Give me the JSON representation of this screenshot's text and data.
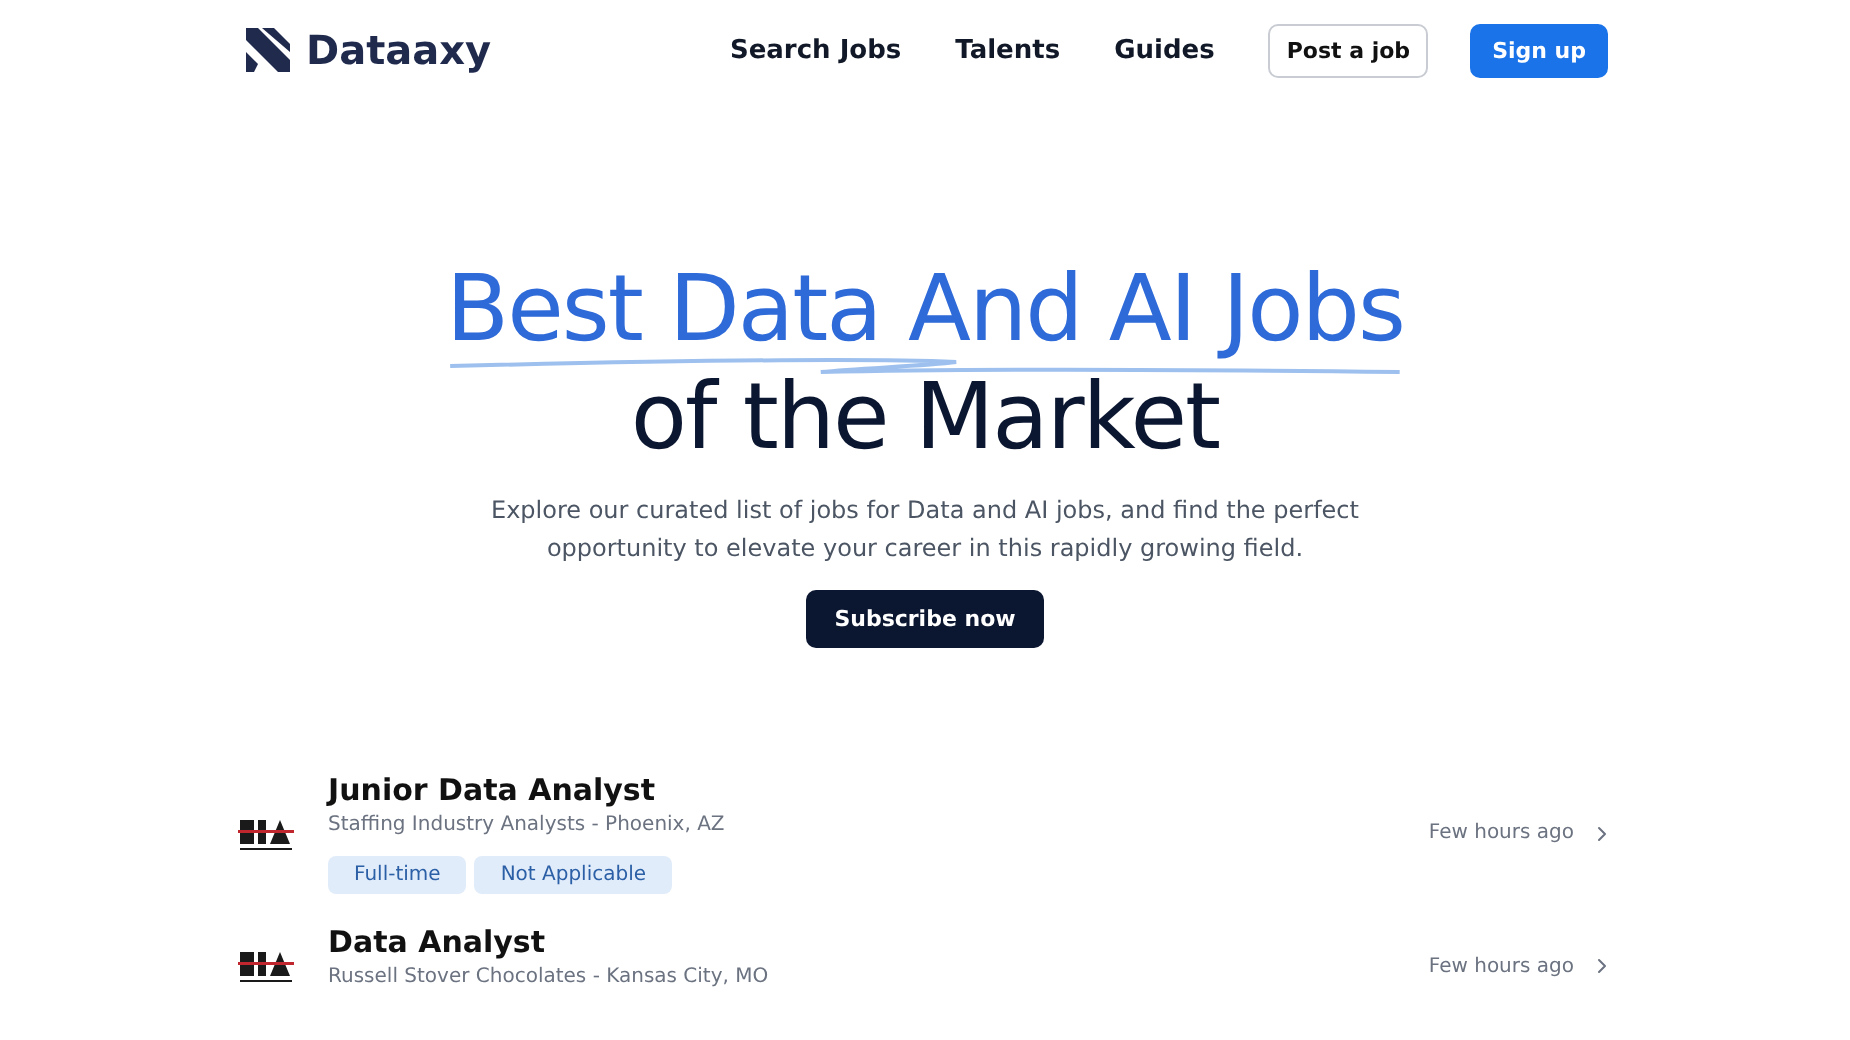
{
  "header": {
    "logo": "Dataaxy",
    "nav": [
      "Search Jobs",
      "Talents",
      "Guides"
    ],
    "post_button": "Post a job",
    "signup_button": "Sign up"
  },
  "hero": {
    "title_line_1": "Best Data And AI Jobs",
    "title_line_2": "of the Market",
    "subtitle": "Explore our curated list of jobs for Data and AI jobs, and find the perfect opportunity to elevate your career in this rapidly growing field.",
    "button": "Subscribe now"
  },
  "jobs": [
    {
      "title": "Junior Data Analyst",
      "company": "Staffing Industry Analysts - Phoenix, AZ",
      "tags": [
        "Full-time",
        "Not Applicable"
      ],
      "posted": "Few hours ago"
    },
    {
      "title": "Data Analyst",
      "company": "Russell Stover Chocolates - Kansas City, MO",
      "posted": "Few hours ago"
    }
  ]
}
